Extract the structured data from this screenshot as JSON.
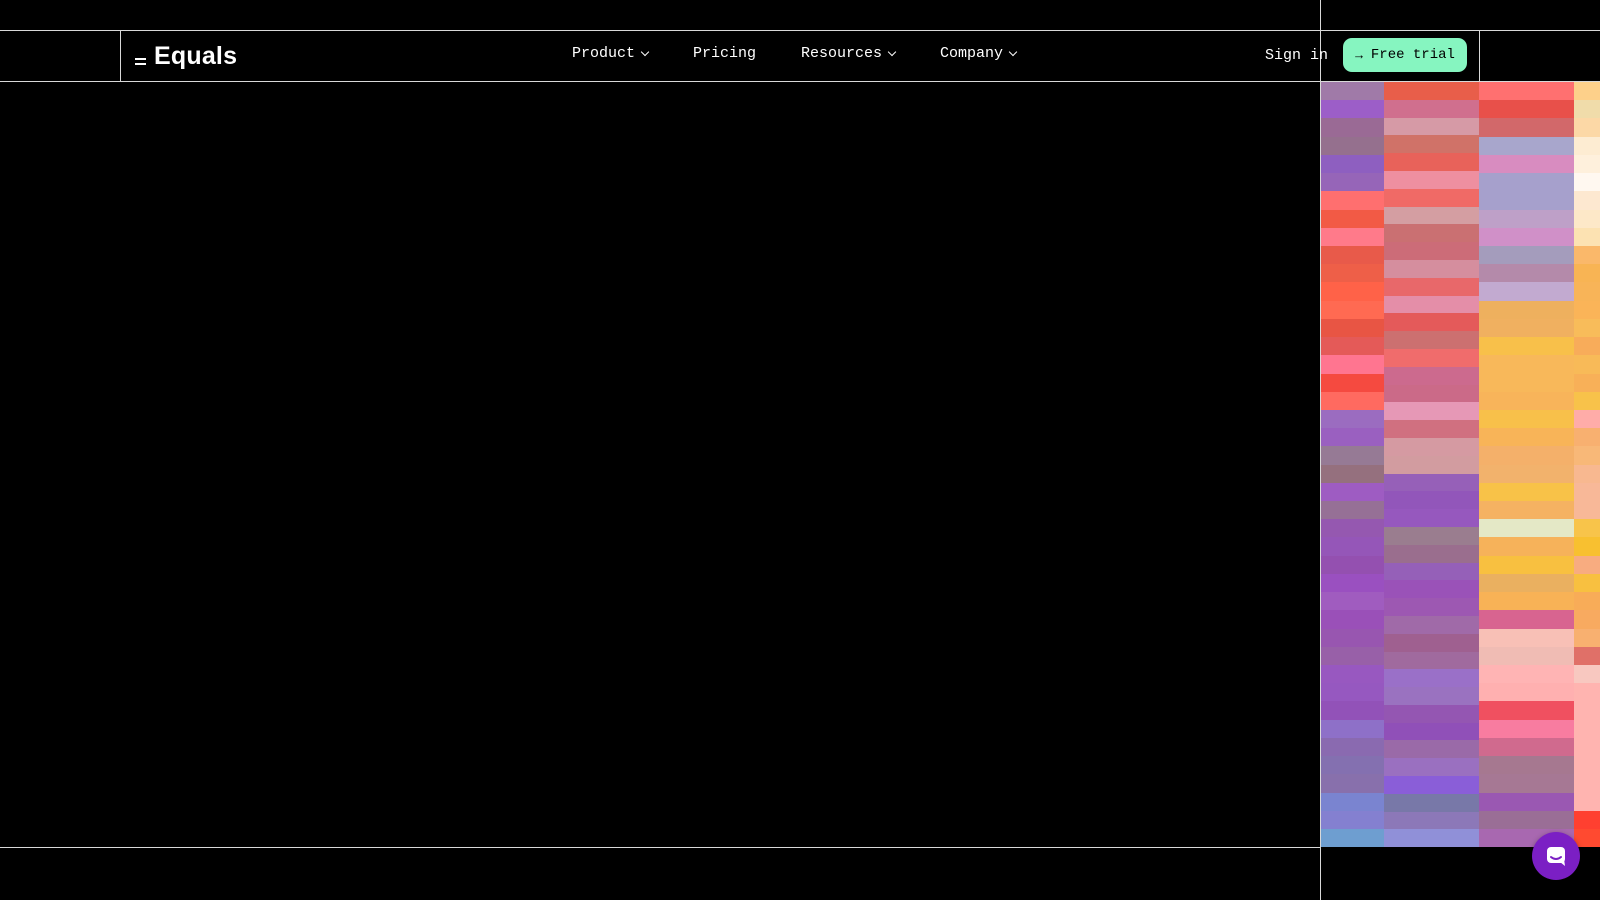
{
  "logo": {
    "text": "Equals"
  },
  "nav": {
    "items": [
      {
        "label": "Product",
        "has_dropdown": true
      },
      {
        "label": "Pricing",
        "has_dropdown": false
      },
      {
        "label": "Resources",
        "has_dropdown": true
      },
      {
        "label": "Company",
        "has_dropdown": true
      }
    ]
  },
  "auth": {
    "sign_in": "Sign in",
    "free_trial": "Free trial",
    "free_trial_icon": "arrow-right-icon"
  },
  "colors": {
    "background": "#000000",
    "trial_button": "#86f5c0",
    "chat_button": "#7b1fc4",
    "mosaic_columns": [
      [
        "#a07aa8",
        "#9c5ec8",
        "#9a6a95",
        "#95708e",
        "#8e5fc0",
        "#9665b8",
        "#ff6f6f",
        "#f25a45",
        "#ff7a8a",
        "#e85a4a",
        "#ee5f48",
        "#ff6248",
        "#ff6a52",
        "#e85544",
        "#e45a58",
        "#ff7590",
        "#f54a40",
        "#ff6a60",
        "#9b6cc0",
        "#9a60c0",
        "#967a95",
        "#95707e",
        "#9e5cc2",
        "#967096",
        "#9558b0",
        "#9556b8",
        "#9450b0",
        "#9a50c0",
        "#a05cbf",
        "#9a50b8",
        "#9856b0",
        "#9860a8",
        "#9858c0",
        "#9658c0",
        "#9252b8",
        "#8e70c8",
        "#8a6ab0",
        "#8470b0",
        "#8870ac",
        "#7a84d0",
        "#8480d0",
        "#6e9ed0"
      ],
      [
        "#e85e4a",
        "#d06f8e",
        "#d69aa6",
        "#d07268",
        "#e8625a",
        "#ee8fa0",
        "#f06a66",
        "#d49ea2",
        "#ca7072",
        "#cc6c78",
        "#d58e9e",
        "#e8686a",
        "#e48ea8",
        "#e45a5a",
        "#cc7070",
        "#f06c6c",
        "#cc6a8e",
        "#cb6a88",
        "#e698b6",
        "#d07080",
        "#d59aa2",
        "#d29ca0",
        "#9660b8",
        "#9256ba",
        "#9658be",
        "#9a7d8f",
        "#9a6e8e",
        "#9560b8",
        "#9a52b8",
        "#9d58b2",
        "#a06aa8",
        "#9f6090",
        "#a06a9e",
        "#9a70c8",
        "#9a72c0",
        "#9456b2",
        "#9050b8",
        "#9a6aa8",
        "#9a70c0",
        "#8a5ed8",
        "#7878a8",
        "#8c78b8",
        "#9090d8"
      ],
      [
        "#ff7070",
        "#e8504a",
        "#d2686a",
        "#a8a6cc",
        "#d88cc0",
        "#a6a0cc",
        "#a6a0cc",
        "#bea0c8",
        "#d090c8",
        "#a49cbc",
        "#b48aaa",
        "#c2aad0",
        "#eeb05e",
        "#f0b060",
        "#f8c04a",
        "#f8b85a",
        "#f8b85a",
        "#f8b45a",
        "#f8c04a",
        "#f8b458",
        "#f4b06a",
        "#f2b26c",
        "#f8c248",
        "#f5b262",
        "#e4e8c6",
        "#f6b25a",
        "#f8c040",
        "#eab060",
        "#f8b256",
        "#d86490",
        "#f8c0b6",
        "#f0bcb4",
        "#ffb4b4",
        "#ffb0b0",
        "#f05060",
        "#f87ca0",
        "#d06a8e",
        "#a67890",
        "#a67894",
        "#9a58b2",
        "#9a6e96",
        "#a868b0"
      ],
      [
        "#fdd08a",
        "#f0dcaa",
        "#fcd8a6",
        "#fdecd2",
        "#fef0dc",
        "#fff8f0",
        "#fde8d0",
        "#fde8c8",
        "#fce2b2",
        "#fab86a",
        "#f8b454",
        "#f8b458",
        "#fab458",
        "#f8bc5a",
        "#f8ac5a",
        "#f8ba58",
        "#f8b058",
        "#f8c24a",
        "#ffaca8",
        "#f8b070",
        "#f8b878",
        "#f8b890",
        "#f8b898",
        "#f8b898",
        "#f8c44a",
        "#f8c030",
        "#f8ac80",
        "#f8c040",
        "#f8ac58",
        "#f8aa60",
        "#f8b070",
        "#e07068",
        "#f8c8c0",
        "#ffb4b0",
        "#ffb4b0",
        "#ffb4b0",
        "#ffb4b0",
        "#ffb4b0",
        "#ffb4b0",
        "#ffb4b0",
        "#ff4030",
        "#ff4a30"
      ]
    ]
  }
}
